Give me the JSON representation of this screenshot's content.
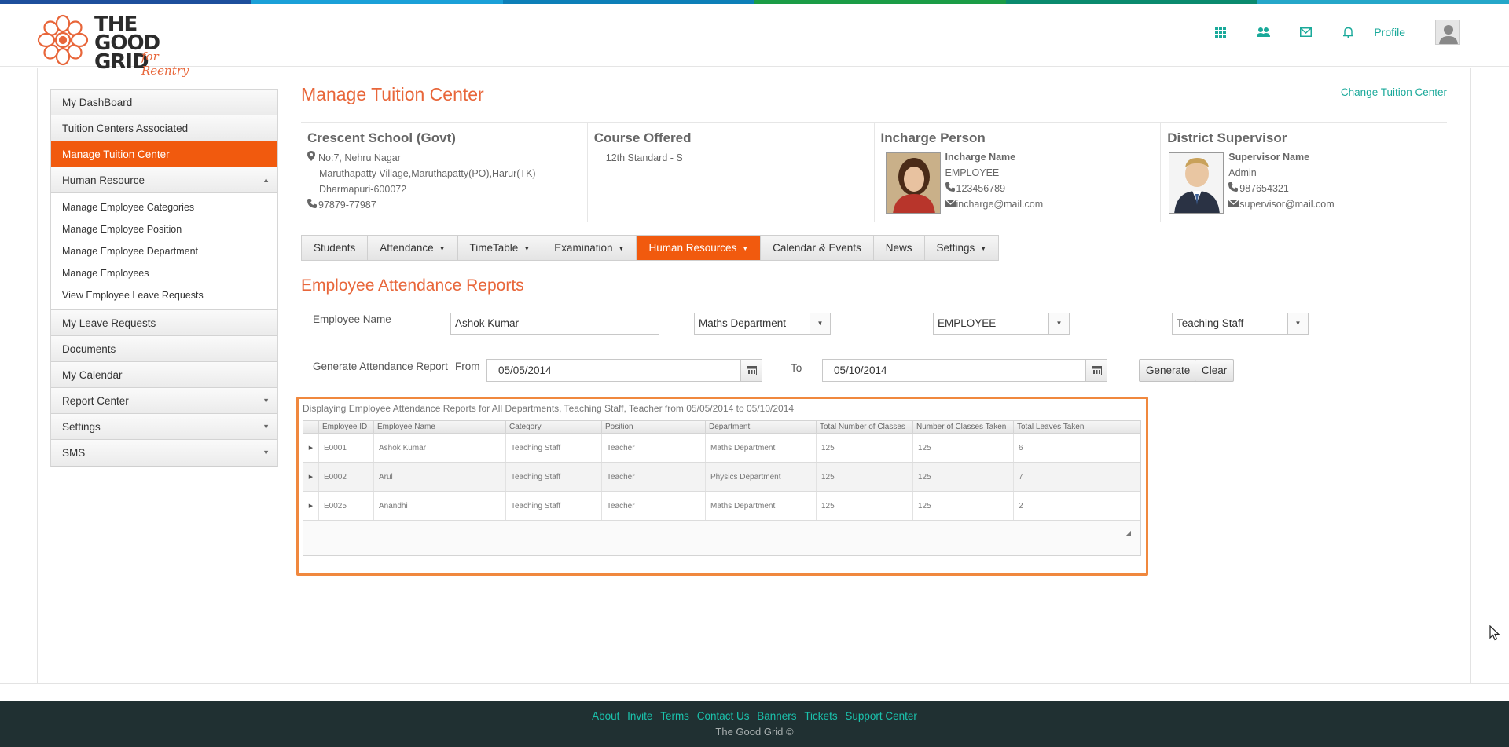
{
  "brand": {
    "logo_name": "THE GOOD GRID",
    "logo_tagline": "for Reentry",
    "stripe_colors": [
      "#1d4f9c",
      "#1aa0d8",
      "#0d7fb8",
      "#1b9c46",
      "#0a8a6e",
      "#25a7c9"
    ]
  },
  "topnav": {
    "icons": [
      "grid-icon",
      "users-icon",
      "mail-icon",
      "bell-icon"
    ],
    "profile_label": "Profile"
  },
  "sidebar": {
    "items": [
      {
        "label": "My DashBoard"
      },
      {
        "label": "Tuition Centers Associated"
      },
      {
        "label": "Manage Tuition Center",
        "active": true
      },
      {
        "label": "Human Resource",
        "expanded": true
      }
    ],
    "sub_items": [
      {
        "label": "Manage Employee Categories"
      },
      {
        "label": "Manage Employee Position"
      },
      {
        "label": "Manage Employee Department"
      },
      {
        "label": "Manage Employees"
      },
      {
        "label": "View Employee Leave Requests"
      }
    ],
    "items_after": [
      {
        "label": "My Leave Requests"
      },
      {
        "label": "Documents"
      },
      {
        "label": "My Calendar"
      },
      {
        "label": "Report Center"
      },
      {
        "label": "Settings"
      },
      {
        "label": "SMS"
      }
    ]
  },
  "page": {
    "title": "Manage Tuition Center",
    "change_link": "Change Tuition Center"
  },
  "info": {
    "school": {
      "name": "Crescent School (Govt)",
      "address_1": "No:7, Nehru Nagar",
      "address_2": "Maruthapatty Village,Maruthapatty(PO),Harur(TK)",
      "address_3": "Dharmapuri-600072",
      "phone": "97879-77987"
    },
    "course": {
      "title": "Course Offered",
      "value": "12th Standard - S"
    },
    "incharge": {
      "title": "Incharge Person",
      "name": "Incharge Name",
      "role": "EMPLOYEE",
      "phone": "123456789",
      "email": "incharge@mail.com"
    },
    "supervisor": {
      "title": "District Supervisor",
      "name": "Supervisor Name",
      "role": "Admin",
      "phone": "987654321",
      "email": "supervisor@mail.com"
    }
  },
  "tabs": [
    {
      "label": "Students",
      "dropdown": false
    },
    {
      "label": "Attendance",
      "dropdown": true
    },
    {
      "label": "TimeTable",
      "dropdown": true
    },
    {
      "label": "Examination",
      "dropdown": true
    },
    {
      "label": "Human Resources",
      "dropdown": true,
      "active": true
    },
    {
      "label": "Calendar & Events",
      "dropdown": false
    },
    {
      "label": "News",
      "dropdown": false
    },
    {
      "label": "Settings",
      "dropdown": true
    }
  ],
  "report": {
    "title": "Employee Attendance Reports",
    "employee_name_label": "Employee Name",
    "employee_name_value": "Ashok Kumar",
    "department_value": "Maths Department",
    "category_value": "EMPLOYEE",
    "staff_type_value": "Teaching Staff",
    "generate_label": "Generate Attendance Report",
    "from_label": "From",
    "from_value": "05/05/2014",
    "to_label": "To",
    "to_value": "05/10/2014",
    "generate_button": "Generate",
    "clear_button": "Clear",
    "caption": "Displaying Employee Attendance Reports  for All Departments, Teaching Staff, Teacher from 05/05/2014 to 05/10/2014"
  },
  "grid": {
    "columns": [
      "Employee ID",
      "Employee Name",
      "Category",
      "Position",
      "Department",
      "Total Number of Classes",
      "Number of Classes Taken",
      "Total Leaves Taken"
    ],
    "rows": [
      [
        "E0001",
        "Ashok Kumar",
        "Teaching Staff",
        "Teacher",
        "Maths Department",
        "125",
        "125",
        "6"
      ],
      [
        "E0002",
        "Arul",
        "Teaching Staff",
        "Teacher",
        "Physics Department",
        "125",
        "125",
        "7"
      ],
      [
        "E0025",
        "Anandhi",
        "Teaching Staff",
        "Teacher",
        "Maths Department",
        "125",
        "125",
        "2"
      ]
    ]
  },
  "footer": {
    "links": [
      "About",
      "Invite",
      "Terms",
      "Contact Us",
      "Banners",
      "Tickets",
      "Support Center"
    ],
    "copyright": "The Good Grid ©"
  }
}
